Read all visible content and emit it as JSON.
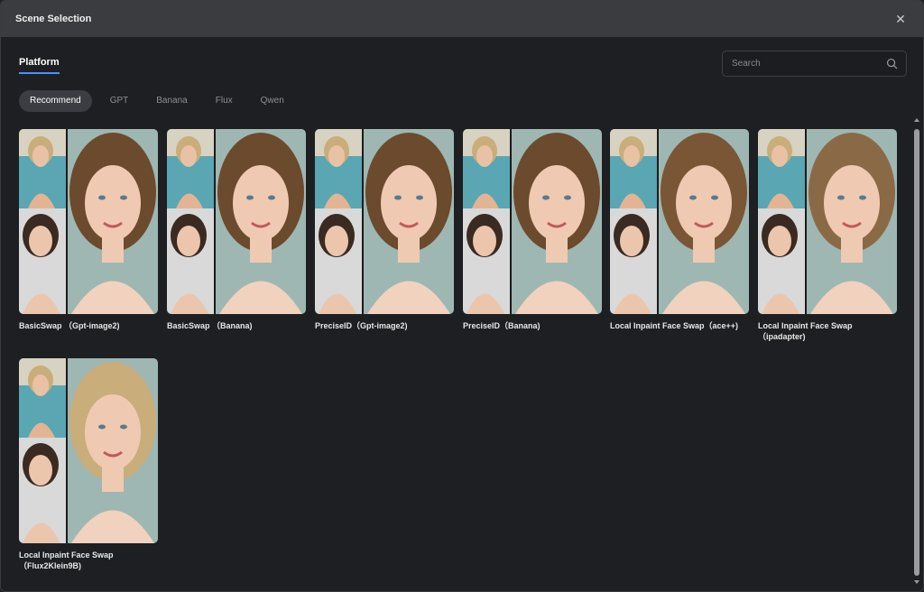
{
  "window": {
    "title": "Scene Selection"
  },
  "tabs": [
    {
      "label": "Platform",
      "active": true
    }
  ],
  "search": {
    "placeholder": "Search"
  },
  "filters": [
    {
      "label": "Recommend",
      "active": true
    },
    {
      "label": "GPT",
      "active": false
    },
    {
      "label": "Banana",
      "active": false
    },
    {
      "label": "Flux",
      "active": false
    },
    {
      "label": "Qwen",
      "active": false
    }
  ],
  "scenes": [
    {
      "label": "BasicSwap （Gpt-image2)"
    },
    {
      "label": "BasicSwap （Banana)"
    },
    {
      "label": "PreciseID（Gpt-image2)"
    },
    {
      "label": "PreciseID（Banana)"
    },
    {
      "label": "Local Inpaint Face Swap（ace++)"
    },
    {
      "label": "Local Inpaint Face Swap\n（ipadapter)"
    },
    {
      "label": "Local Inpaint Face Swap\n（Flux2Klein9B)"
    }
  ],
  "colors": {
    "accent": "#4d8dff",
    "background": "#1e1f22",
    "titlebar": "#3b3c40"
  }
}
